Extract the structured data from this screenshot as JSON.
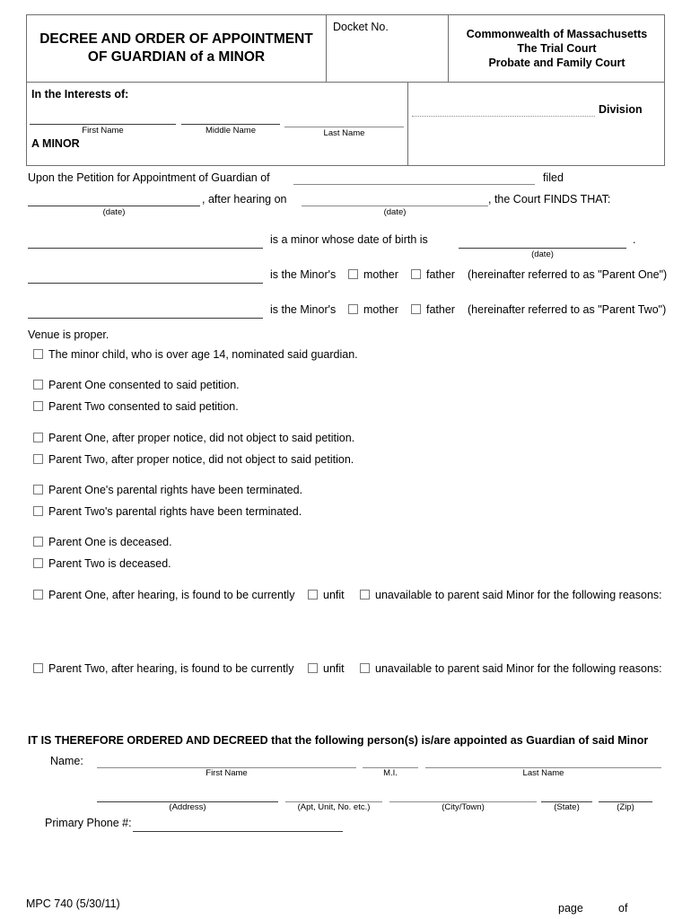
{
  "header": {
    "form_title": "DECREE AND ORDER OF APPOINTMENT OF GUARDIAN of a MINOR",
    "docket_label": "Docket No.",
    "court_line1": "Commonwealth of Massachusetts",
    "court_line2": "The Trial Court",
    "court_line3": "Probate and Family Court",
    "in_the_interests_of": "In the Interests of:",
    "first_name_caption": "First Name",
    "middle_name_caption": "Middle Name",
    "last_name_caption": "Last Name",
    "a_minor": "A MINOR",
    "division_label": "Division"
  },
  "petition": {
    "line1_prefix": "Upon the Petition for Appointment of Guardian of",
    "line1_suffix": "filed",
    "date_caption": "(date)",
    "line2_mid": ", after hearing on",
    "line2_suffix": ", the Court FINDS THAT:"
  },
  "findings": {
    "minor_dob_text": "is a minor whose date of birth is",
    "dob_caption": "(date)",
    "dob_period": ".",
    "parent_prefix": "is the Minor's",
    "mother_label": "mother",
    "father_label": "father",
    "parent_one_suffix": "(hereinafter referred to as \"Parent One\")",
    "parent_two_suffix": "(hereinafter referred to as \"Parent Two\")"
  },
  "venue": "Venue is proper.",
  "checklist": [
    {
      "label": "The minor child, who is over age 14, nominated said guardian."
    },
    {
      "label": "Parent One consented to said petition."
    },
    {
      "label": "Parent Two consented to said petition."
    },
    {
      "label": "Parent One, after proper notice, did not object to said petition."
    },
    {
      "label": "Parent Two, after proper notice, did not object to said petition."
    },
    {
      "label": "Parent One's parental rights have been terminated."
    },
    {
      "label": "Parent Two's parental rights have been terminated."
    },
    {
      "label": "Parent One is deceased."
    },
    {
      "label": "Parent Two is deceased."
    }
  ],
  "hearing_findings": {
    "parent_one_prefix": "Parent One, after hearing, is found to be currently",
    "parent_two_prefix": "Parent Two, after hearing, is found to be currently",
    "unfit_label": "unfit",
    "unavailable_label": "unavailable to parent said Minor for the following reasons:"
  },
  "order": {
    "decree_text": "IT IS THEREFORE ORDERED AND DECREED that the following person(s) is/are appointed as Guardian of said Minor",
    "name_label": "Name:",
    "first_name_caption": "First Name",
    "mi_caption": "M.I.",
    "last_name_caption": "Last Name",
    "address_caption": "(Address)",
    "apt_caption": "(Apt, Unit, No. etc.)",
    "city_caption": "(City/Town)",
    "state_caption": "(State)",
    "zip_caption": "(Zip)",
    "phone_label": "Primary Phone #:"
  },
  "footer": {
    "form_number": "MPC 740 (5/30/11)",
    "page_label": "page",
    "of_label": "of"
  }
}
